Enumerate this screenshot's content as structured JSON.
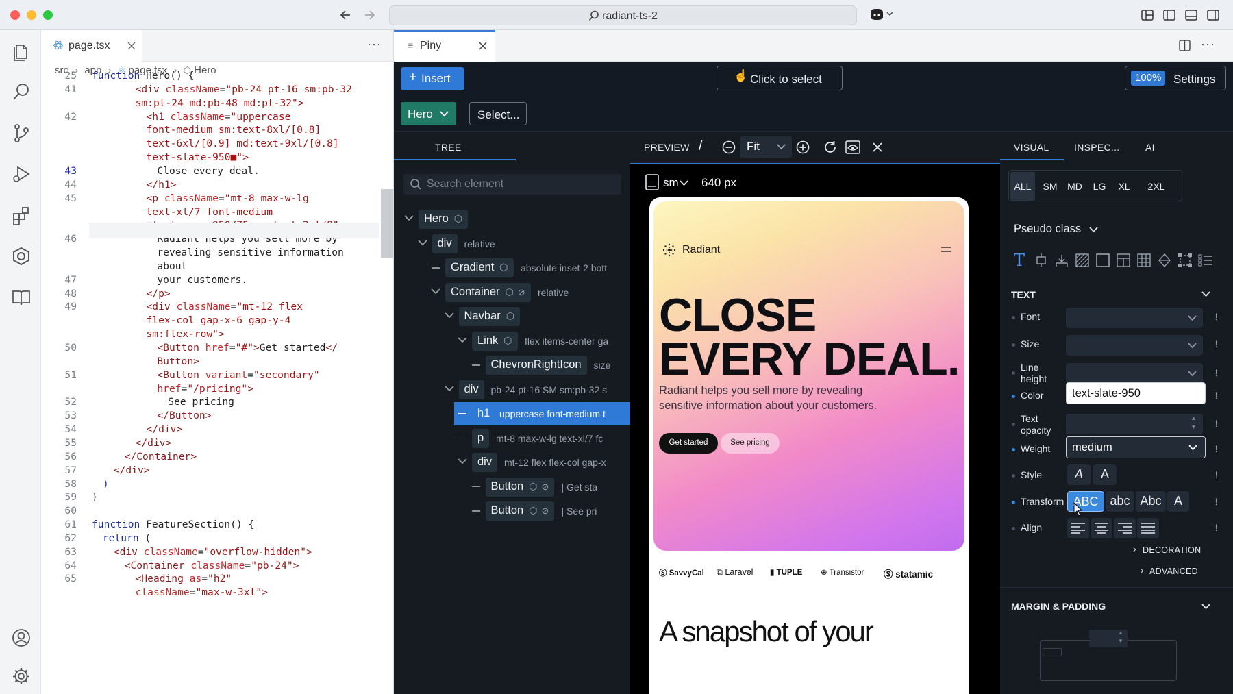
{
  "window": {
    "url": "radiant-ts-2"
  },
  "editor": {
    "tab_label": "page.tsx",
    "breadcrumb": [
      "src",
      "app",
      "page.tsx",
      "Hero"
    ],
    "lines": [
      {
        "n": "25",
        "segs": [
          [
            "kw",
            "function "
          ],
          [
            "pl",
            "Hero() {"
          ]
        ],
        "indent": 0
      },
      {
        "n": "41",
        "segs": [
          [
            "tg",
            "<div "
          ],
          [
            "at",
            "className"
          ],
          [
            "pl",
            "="
          ],
          [
            "st",
            "\"pb-24 pt-16 sm:pb-32"
          ]
        ],
        "indent": 4
      },
      {
        "n": "",
        "segs": [
          [
            "st",
            "sm:pt-24 md:pb-48 md:pt-32\""
          ],
          [
            "tg",
            ">"
          ]
        ],
        "indent": 4
      },
      {
        "n": "42",
        "segs": [
          [
            "tg",
            "<h1 "
          ],
          [
            "at",
            "className"
          ],
          [
            "pl",
            "="
          ],
          [
            "st",
            "\"uppercase"
          ]
        ],
        "indent": 5
      },
      {
        "n": "",
        "segs": [
          [
            "st",
            "font-medium sm:text-8xl/[0.8]"
          ]
        ],
        "indent": 5
      },
      {
        "n": "",
        "segs": [
          [
            "st",
            "text-6xl/[0.9] md:text-9xl/[0.8]"
          ]
        ],
        "indent": 5
      },
      {
        "n": "",
        "segs": [
          [
            "st",
            "text-slate-950■\""
          ],
          [
            "tg",
            ">"
          ]
        ],
        "indent": 5
      },
      {
        "n": "43",
        "segs": [
          [
            "pl",
            "Close every deal."
          ]
        ],
        "indent": 6
      },
      {
        "n": "44",
        "segs": [
          [
            "tg",
            "</h1>"
          ]
        ],
        "indent": 5
      },
      {
        "n": "45",
        "segs": [
          [
            "tg",
            "<p "
          ],
          [
            "at",
            "className"
          ],
          [
            "pl",
            "="
          ],
          [
            "st",
            "\"mt-8 max-w-lg"
          ]
        ],
        "indent": 5
      },
      {
        "n": "",
        "segs": [
          [
            "st",
            "text-xl/7 font-medium"
          ]
        ],
        "indent": 5
      },
      {
        "n": "",
        "segs": [
          [
            "st",
            "■text-gray-950/75 sm:text-2xl/8\""
          ],
          [
            "tg",
            ">"
          ]
        ],
        "indent": 5
      },
      {
        "n": "46",
        "segs": [
          [
            "pl",
            "Radiant helps you sell more by"
          ]
        ],
        "indent": 6
      },
      {
        "n": "",
        "segs": [
          [
            "pl",
            "revealing sensitive information"
          ]
        ],
        "indent": 6
      },
      {
        "n": "",
        "segs": [
          [
            "pl",
            "about"
          ]
        ],
        "indent": 6
      },
      {
        "n": "47",
        "segs": [
          [
            "pl",
            "your customers."
          ]
        ],
        "indent": 6
      },
      {
        "n": "48",
        "segs": [
          [
            "tg",
            "</p>"
          ]
        ],
        "indent": 5
      },
      {
        "n": "49",
        "segs": [
          [
            "tg",
            "<div "
          ],
          [
            "at",
            "className"
          ],
          [
            "pl",
            "="
          ],
          [
            "st",
            "\"mt-12 flex"
          ]
        ],
        "indent": 5
      },
      {
        "n": "",
        "segs": [
          [
            "st",
            "flex-col gap-x-6 gap-y-4"
          ]
        ],
        "indent": 5
      },
      {
        "n": "",
        "segs": [
          [
            "st",
            "sm:flex-row\""
          ],
          [
            "tg",
            ">"
          ]
        ],
        "indent": 5
      },
      {
        "n": "50",
        "segs": [
          [
            "tg",
            "<Button "
          ],
          [
            "at",
            "href"
          ],
          [
            "pl",
            "="
          ],
          [
            "st",
            "\"#\""
          ],
          [
            "tg",
            ">"
          ],
          [
            "pl",
            "Get started"
          ],
          [
            "tg",
            "</"
          ]
        ],
        "indent": 6
      },
      {
        "n": "",
        "segs": [
          [
            "tg",
            "Button>"
          ]
        ],
        "indent": 6
      },
      {
        "n": "51",
        "segs": [
          [
            "tg",
            "<Button "
          ],
          [
            "at",
            "variant"
          ],
          [
            "pl",
            "="
          ],
          [
            "st",
            "\"secondary\""
          ]
        ],
        "indent": 6
      },
      {
        "n": "",
        "segs": [
          [
            "at",
            "href"
          ],
          [
            "pl",
            "="
          ],
          [
            "st",
            "\"/pricing\""
          ],
          [
            "tg",
            ">"
          ]
        ],
        "indent": 6
      },
      {
        "n": "52",
        "segs": [
          [
            "pl",
            "See pricing"
          ]
        ],
        "indent": 7
      },
      {
        "n": "53",
        "segs": [
          [
            "tg",
            "</Button>"
          ]
        ],
        "indent": 6
      },
      {
        "n": "54",
        "segs": [
          [
            "tg",
            "</div>"
          ]
        ],
        "indent": 5
      },
      {
        "n": "55",
        "segs": [
          [
            "tg",
            "</div>"
          ]
        ],
        "indent": 4
      },
      {
        "n": "56",
        "segs": [
          [
            "tg",
            "</Container>"
          ]
        ],
        "indent": 3
      },
      {
        "n": "57",
        "segs": [
          [
            "tg",
            "</div>"
          ]
        ],
        "indent": 2
      },
      {
        "n": "58",
        "segs": [
          [
            "kw",
            ")"
          ]
        ],
        "indent": 1
      },
      {
        "n": "59",
        "segs": [
          [
            "pl",
            "}"
          ]
        ],
        "indent": 0
      },
      {
        "n": "60",
        "segs": [],
        "indent": 0
      },
      {
        "n": "61",
        "segs": [
          [
            "kw",
            "function "
          ],
          [
            "pl",
            "FeatureSection() {"
          ]
        ],
        "indent": 0
      },
      {
        "n": "62",
        "segs": [
          [
            "kw",
            "return "
          ],
          [
            "pl",
            "("
          ]
        ],
        "indent": 1
      },
      {
        "n": "63",
        "segs": [
          [
            "tg",
            "<div "
          ],
          [
            "at",
            "className"
          ],
          [
            "pl",
            "="
          ],
          [
            "st",
            "\"overflow-hidden\""
          ],
          [
            "tg",
            ">"
          ]
        ],
        "indent": 2
      },
      {
        "n": "64",
        "segs": [
          [
            "tg",
            "<Container "
          ],
          [
            "at",
            "className"
          ],
          [
            "pl",
            "="
          ],
          [
            "st",
            "\"pb-24\""
          ],
          [
            "tg",
            ">"
          ]
        ],
        "indent": 3
      },
      {
        "n": "65",
        "segs": [
          [
            "tg",
            "<Heading "
          ],
          [
            "at",
            "as"
          ],
          [
            "pl",
            "="
          ],
          [
            "st",
            "\"h2\""
          ]
        ],
        "indent": 4
      },
      {
        "n": "",
        "segs": [
          [
            "at",
            "className"
          ],
          [
            "pl",
            "="
          ],
          [
            "st",
            "\"max-w-3xl\""
          ],
          [
            "tg",
            ">"
          ]
        ],
        "indent": 4
      }
    ]
  },
  "plugin": {
    "tab_label": "Piny",
    "insert_label": "Insert",
    "click_select_label": "Click to select",
    "zoom_badge": "100%",
    "settings_label": "Settings",
    "component_label": "Hero",
    "select_label": "Select...",
    "tree_tab": "TREE",
    "preview_tab": "PREVIEW",
    "slash": "/",
    "fit_label": "Fit",
    "search_placeholder": "Search element",
    "viewport_label": "sm",
    "viewport_px": "640 px",
    "visual_tab": "VISUAL",
    "inspect_tab": "INSPEC...",
    "ai_tab": "AI"
  },
  "tree": [
    {
      "depth": 0,
      "name": "Hero",
      "kind": "chevron",
      "cube": true,
      "eye": false,
      "cls": "",
      "selected": false
    },
    {
      "depth": 1,
      "name": "div",
      "kind": "chevron",
      "cube": false,
      "eye": false,
      "cls": "relative",
      "selected": false
    },
    {
      "depth": 2,
      "name": "Gradient",
      "kind": "dash",
      "cube": true,
      "eye": false,
      "cls": "absolute inset-2 bott",
      "selected": false
    },
    {
      "depth": 2,
      "name": "Container",
      "kind": "chevron",
      "cube": true,
      "eye": true,
      "cls": "relative",
      "selected": false
    },
    {
      "depth": 3,
      "name": "Navbar",
      "kind": "chevron",
      "cube": true,
      "eye": false,
      "cls": "",
      "selected": false
    },
    {
      "depth": 4,
      "name": "Link",
      "kind": "chevron",
      "cube": true,
      "eye": false,
      "cls": "flex items-center ga",
      "selected": false
    },
    {
      "depth": 5,
      "name": "ChevronRightIcon",
      "kind": "dash",
      "cube": false,
      "eye": false,
      "cls": "size",
      "selected": false
    },
    {
      "depth": 3,
      "name": "div",
      "kind": "chevron",
      "cube": false,
      "eye": false,
      "cls": "pb-24 pt-16 SM sm:pb-32 s",
      "selected": false
    },
    {
      "depth": 4,
      "name": "h1",
      "kind": "dash",
      "cube": false,
      "eye": false,
      "cls": "uppercase font-medium t",
      "selected": true
    },
    {
      "depth": 4,
      "name": "p",
      "kind": "dash",
      "cube": false,
      "eye": false,
      "cls": "mt-8 max-w-lg text-xl/7 fc",
      "selected": false
    },
    {
      "depth": 4,
      "name": "div",
      "kind": "chevron",
      "cube": false,
      "eye": false,
      "cls": "mt-12 flex flex-col gap-x",
      "selected": false
    },
    {
      "depth": 5,
      "name": "Button",
      "kind": "dash",
      "cube": true,
      "eye": true,
      "cls": "| Get sta",
      "selected": false
    },
    {
      "depth": 5,
      "name": "Button",
      "kind": "dash",
      "cube": true,
      "eye": true,
      "cls": "| See pri",
      "selected": false
    }
  ],
  "site": {
    "brand": "Radiant",
    "headline_1": "CLOSE",
    "headline_2": "EVERY DEAL.",
    "subtext_1": "Radiant helps you sell more by revealing",
    "subtext_2": "sensitive information about your customers.",
    "cta_primary": "Get started",
    "cta_secondary": "See pricing",
    "logos": [
      "SavvyCal",
      "Laravel",
      "TUPLE",
      "Transistor",
      "statamic"
    ],
    "section_heading": "A snapshot of your"
  },
  "inspector": {
    "breakpoints": [
      "ALL",
      "SM",
      "MD",
      "LG",
      "XL",
      "2XL"
    ],
    "active_breakpoint": "ALL",
    "pseudo_class_label": "Pseudo class",
    "text_section": "TEXT",
    "font_label": "Font",
    "size_label": "Size",
    "line_height_label_1": "Line",
    "line_height_label_2": "height",
    "color_label": "Color",
    "color_value": "text-slate-950",
    "text_opacity_label_1": "Text",
    "text_opacity_label_2": "opacity",
    "weight_label": "Weight",
    "weight_value": "medium",
    "style_label": "Style",
    "style_options": [
      "A",
      "A"
    ],
    "transform_label": "Transform",
    "transform_options": [
      "ABC",
      "abc",
      "Abc",
      "A"
    ],
    "align_label": "Align",
    "decoration_label": "DECORATION",
    "advanced_label": "ADVANCED",
    "margin_section": "MARGIN & PADDING",
    "bang": "!"
  },
  "colors": {
    "accent": "#2f7ad6",
    "panel_bg": "#161b22",
    "component_green": "#1f7a66"
  }
}
